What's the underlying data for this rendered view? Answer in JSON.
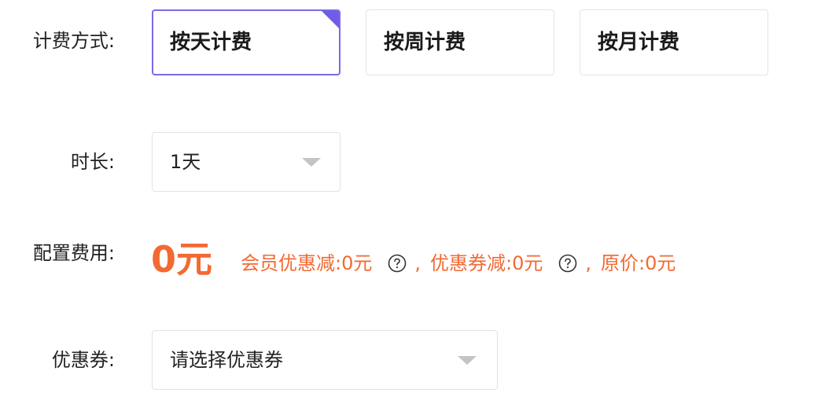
{
  "billing": {
    "label": "计费方式:",
    "options": [
      {
        "label": "按天计费",
        "selected": true
      },
      {
        "label": "按周计费",
        "selected": false
      },
      {
        "label": "按月计费",
        "selected": false
      }
    ]
  },
  "duration": {
    "label": "时长:",
    "value": "1天"
  },
  "fee": {
    "label": "配置费用:",
    "amount": "0元",
    "member_discount": "会员优惠减:0元",
    "separator1": ",",
    "coupon_discount": "优惠券减:0元",
    "separator2": ",",
    "original_price": "原价:0元"
  },
  "coupon": {
    "label": "优惠券:",
    "placeholder": "请选择优惠券"
  },
  "icons": {
    "help": "question-circle-icon",
    "dropdown": "caret-down-icon",
    "selected_corner": "corner-check-icon"
  },
  "colors": {
    "accent": "#6f5de8",
    "price": "#f26a33",
    "border": "#e3e3e3",
    "caret": "#c4c4c4"
  }
}
